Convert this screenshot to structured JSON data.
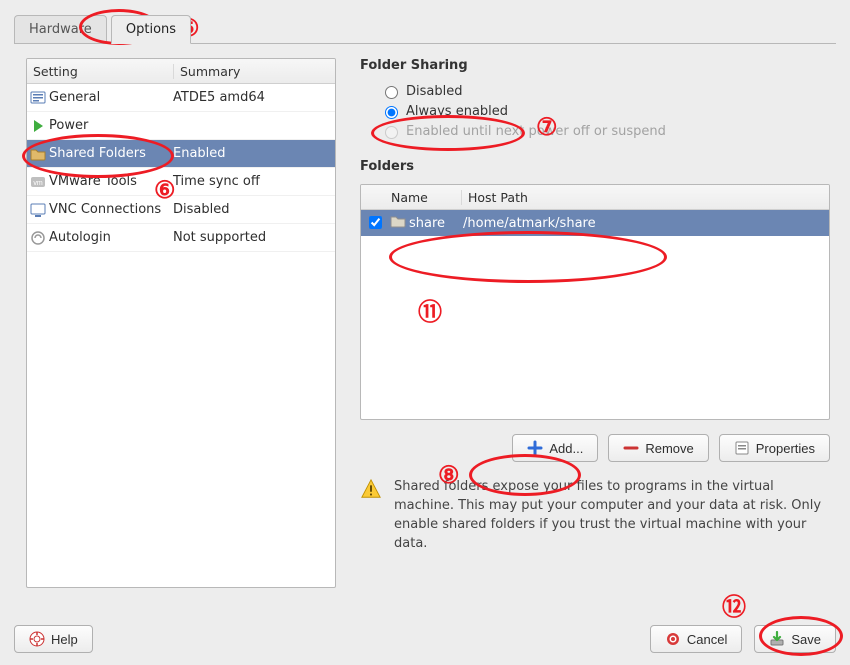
{
  "tabs": {
    "hardware": "Hardware",
    "options": "Options"
  },
  "list": {
    "header_setting": "Setting",
    "header_summary": "Summary",
    "rows": [
      {
        "icon": "general-icon",
        "setting": "General",
        "summary": "ATDE5 amd64"
      },
      {
        "icon": "power-icon",
        "setting": "Power",
        "summary": ""
      },
      {
        "icon": "folder-icon",
        "setting": "Shared Folders",
        "summary": "Enabled",
        "selected": true
      },
      {
        "icon": "vmware-icon",
        "setting": "VMware Tools",
        "summary": "Time sync off"
      },
      {
        "icon": "vnc-icon",
        "setting": "VNC Connections",
        "summary": "Disabled"
      },
      {
        "icon": "autologin-icon",
        "setting": "Autologin",
        "summary": "Not supported"
      }
    ]
  },
  "folder_sharing": {
    "title": "Folder Sharing",
    "radio_disabled": "Disabled",
    "radio_always": "Always enabled",
    "radio_until": "Enabled until next power off or suspend"
  },
  "folders": {
    "title": "Folders",
    "header_name": "Name",
    "header_host": "Host Path",
    "row": {
      "name": "share",
      "host": "/home/atmark/share"
    },
    "add": "Add...",
    "remove": "Remove",
    "properties": "Properties"
  },
  "warning": "Shared folders expose your files to programs in the virtual machine. This may put your computer and your data at risk. Only enable shared folders if you trust the virtual machine with your data.",
  "buttons": {
    "help": "Help",
    "cancel": "Cancel",
    "save": "Save"
  },
  "annotations": {
    "n5": "⑤",
    "n6": "⑥",
    "n7": "⑦",
    "n8": "⑧",
    "n11": "⑪",
    "n12": "⑫"
  }
}
